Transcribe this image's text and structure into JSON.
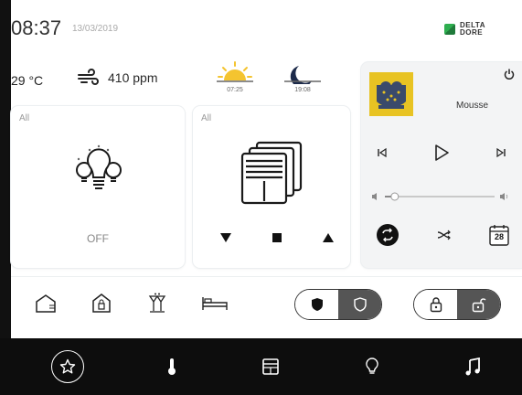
{
  "header": {
    "time": "08:37",
    "date": "13/03/2019",
    "brand_line1": "DELTA",
    "brand_line2": "DORE"
  },
  "weather": {
    "temperature": "29 °C",
    "air_quality": "410 ppm",
    "sunrise": "07:25",
    "sunset": "19:08"
  },
  "lights": {
    "label": "All",
    "status": "OFF",
    "icon": "light-bulbs-icon"
  },
  "shutters": {
    "label": "All",
    "icon": "shutters-icon",
    "controls": [
      "down-arrow-icon",
      "stop-icon",
      "up-arrow-icon"
    ]
  },
  "music": {
    "track": "Mousse",
    "icons": [
      "power-icon",
      "previous-icon",
      "play-icon",
      "next-icon",
      "volume-down-icon",
      "volume-up-icon",
      "repeat-icon",
      "shuffle-icon",
      "calendar-icon"
    ],
    "calendar_day": "28",
    "volume": 0.09
  },
  "scenes": {
    "icons": [
      "house-away-icon",
      "house-lock-icon",
      "party-icon",
      "bed-icon"
    ],
    "alarm_toggle": [
      "shield-filled-icon",
      "shield-outline-icon"
    ],
    "lock_toggle": [
      "lock-closed-icon",
      "lock-open-icon"
    ]
  },
  "nav": {
    "items": [
      "favorites-star-icon",
      "thermometer-icon",
      "shutter-nav-icon",
      "lightbulb-icon",
      "music-note-icon"
    ]
  },
  "colors": {
    "accent_green": "#2eae4f",
    "album_yellow": "#e8c323",
    "nav_bg": "#0d0d0d",
    "toggle_fill": "#555555"
  }
}
